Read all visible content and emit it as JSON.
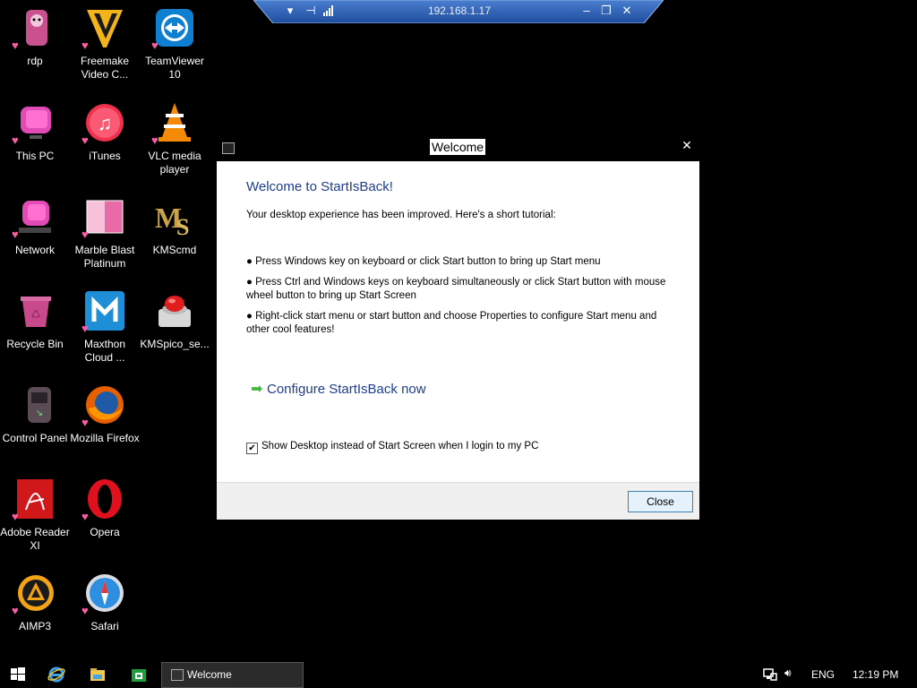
{
  "rdp_bar": {
    "title": "192.168.1.17",
    "buttons": [
      "chevron-down-icon",
      "pin-icon",
      "signal-icon",
      "minimize-icon",
      "restore-icon",
      "close-icon"
    ]
  },
  "desktop_icons": [
    {
      "label": "rdp",
      "icon": "rdp-icon"
    },
    {
      "label": "Freemake Video C...",
      "icon": "freemake-icon"
    },
    {
      "label": "TeamViewer 10",
      "icon": "teamviewer-icon"
    },
    {
      "label": "This PC",
      "icon": "this-pc-icon"
    },
    {
      "label": "iTunes",
      "icon": "itunes-icon"
    },
    {
      "label": "VLC media player",
      "icon": "vlc-icon"
    },
    {
      "label": "Network",
      "icon": "network-icon"
    },
    {
      "label": "Marble Blast Platinum",
      "icon": "marble-blast-icon"
    },
    {
      "label": "KMScmd",
      "icon": "kmscmd-icon"
    },
    {
      "label": "Recycle Bin",
      "icon": "recycle-bin-icon"
    },
    {
      "label": "Maxthon Cloud ...",
      "icon": "maxthon-icon"
    },
    {
      "label": "KMSpico_se...",
      "icon": "kmspico-icon"
    },
    {
      "label": "Control Panel",
      "icon": "control-panel-icon"
    },
    {
      "label": "Mozilla Firefox",
      "icon": "firefox-icon"
    },
    {
      "label": "Adobe Reader XI",
      "icon": "adobe-reader-icon"
    },
    {
      "label": "Opera",
      "icon": "opera-icon"
    },
    {
      "label": "AIMP3",
      "icon": "aimp-icon"
    },
    {
      "label": "Safari",
      "icon": "safari-icon"
    }
  ],
  "dialog": {
    "title": "Welcome",
    "heading": "Welcome to StartIsBack!",
    "intro": "Your desktop experience has been improved. Here's a short tutorial:",
    "bullets": [
      "● Press Windows key on keyboard or click Start button to bring up Start menu",
      "● Press Ctrl and Windows keys on keyboard simultaneously or click Start button with mouse wheel button to bring up Start Screen",
      "● Right-click start menu or start button and choose Properties to configure Start menu and other cool features!"
    ],
    "configure_link": "Configure StartIsBack now",
    "checkbox_label": "Show Desktop instead of Start Screen when I login to my PC",
    "checkbox_checked": true,
    "close_button": "Close"
  },
  "taskbar": {
    "active_window": "Welcome",
    "language": "ENG",
    "time": "12:19 PM"
  },
  "colors": {
    "dialog_heading": "#1e3d8f",
    "link_arrow": "#3fb93a",
    "rdp_bar": "#2f62b4"
  }
}
